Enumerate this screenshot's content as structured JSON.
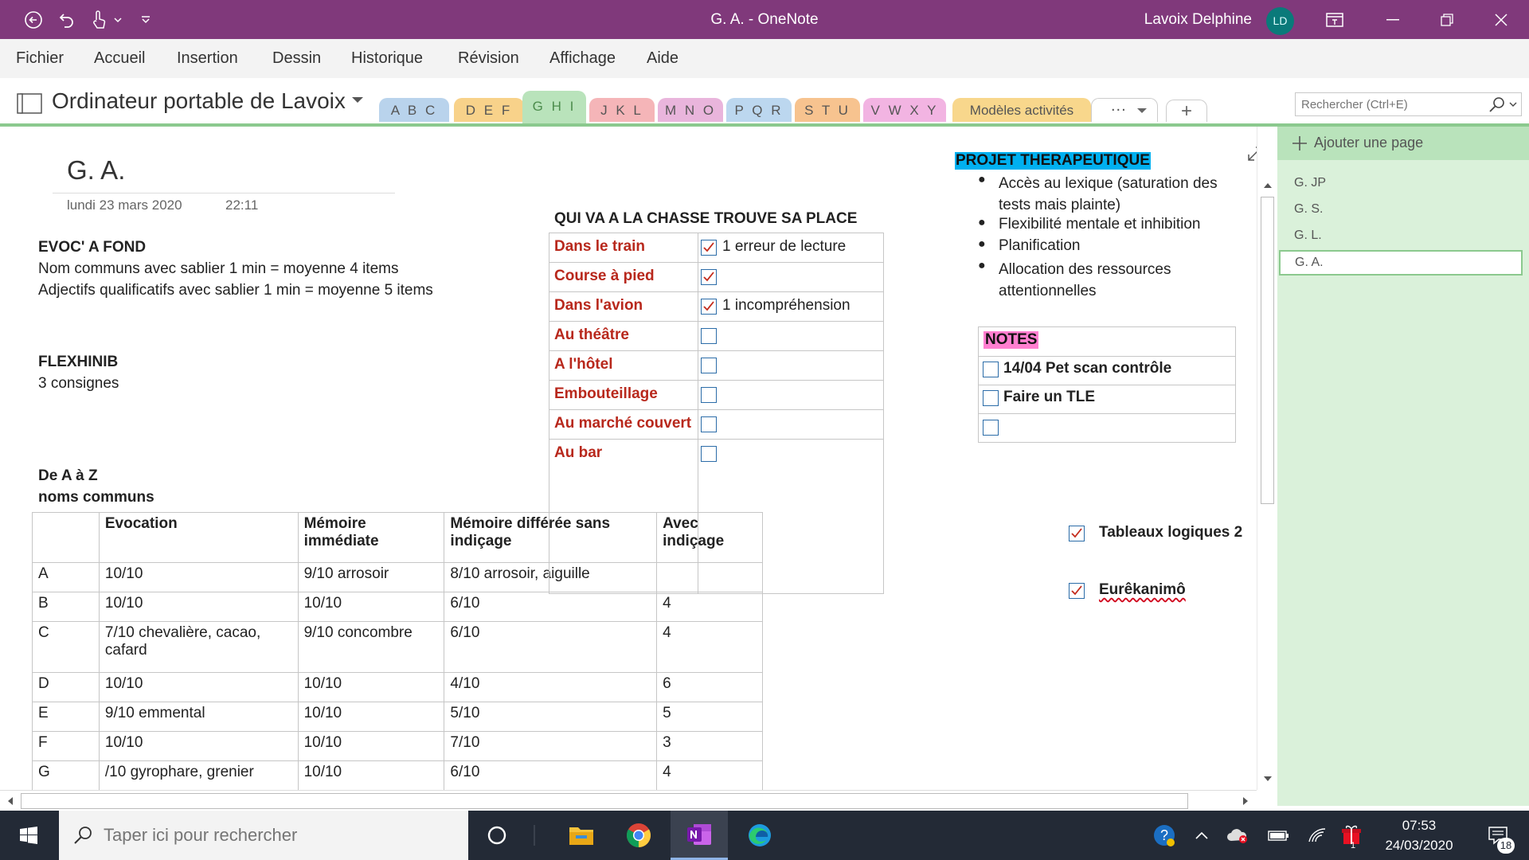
{
  "titlebar": {
    "title": "G. A.  -  OneNote",
    "user": "Lavoix Delphine",
    "avatar_initials": "LD",
    "accent": "#80397b"
  },
  "menu": [
    "Fichier",
    "Accueil",
    "Insertion",
    "Dessin",
    "Historique",
    "Révision",
    "Affichage",
    "Aide"
  ],
  "notebook": {
    "name": "Ordinateur portable de Lavoix",
    "tabs": [
      {
        "label": "A B C",
        "color": "#b9d3ec"
      },
      {
        "label": "D E F",
        "color": "#f8d28a"
      },
      {
        "label": "G H I",
        "color": "#b9e3bb",
        "active": true
      },
      {
        "label": "J K L",
        "color": "#f5b5b8"
      },
      {
        "label": "M N O",
        "color": "#e9b5dc"
      },
      {
        "label": "P Q R",
        "color": "#bcd7ef"
      },
      {
        "label": "S T U",
        "color": "#f7c38f"
      },
      {
        "label": "V W X Y Z",
        "color": "#f2b4e2"
      },
      {
        "label": "Modèles activités",
        "color": "#f8d78c"
      }
    ],
    "more_label": "...",
    "add_label": "+",
    "search_placeholder": "Rechercher (Ctrl+E)"
  },
  "page": {
    "title": "G. A.",
    "date": "lundi 23 mars 2020",
    "time": "22:11",
    "evoc": {
      "heading": "EVOC' A FOND",
      "line1": "Nom communs avec sablier 1 min = moyenne 4 items",
      "line2": "Adjectifs qualificatifs avec sablier 1 min = moyenne 5 items"
    },
    "flex": {
      "heading": "FLEXHINIB",
      "line": "3 consignes"
    },
    "az": {
      "heading": "De A à Z",
      "subheading": "noms communs"
    },
    "az_table": {
      "headers": [
        "",
        "Evocation",
        "Mémoire immédiate",
        "Mémoire différée sans indiçage",
        "Avec indiçage"
      ],
      "rows": [
        [
          "A",
          "10/10",
          "9/10 arrosoir",
          "8/10 arrosoir, aiguille",
          ""
        ],
        [
          "B",
          "10/10",
          "10/10",
          "6/10",
          "4"
        ],
        [
          "C",
          "7/10 chevalière, cacao, cafard",
          "9/10 concombre",
          "6/10",
          "4"
        ],
        [
          "D",
          "10/10",
          "10/10",
          "4/10",
          "6"
        ],
        [
          "E",
          "9/10  emmental",
          "10/10",
          "5/10",
          "5"
        ],
        [
          "F",
          "10/10",
          "10/10",
          "7/10",
          "3"
        ],
        [
          "G",
          "/10 gyrophare, grenier",
          "10/10",
          "6/10",
          "4"
        ]
      ]
    },
    "chasse": {
      "heading": "QUI VA A LA CHASSE TROUVE SA PLACE",
      "rows": [
        {
          "label": "Dans le train",
          "checked": true,
          "note": "1 erreur de lecture"
        },
        {
          "label": "Course à pied",
          "checked": true,
          "note": ""
        },
        {
          "label": "Dans l'avion",
          "checked": true,
          "note": "1 incompréhension"
        },
        {
          "label": "Au théâtre",
          "checked": false,
          "note": ""
        },
        {
          "label": "A l'hôtel",
          "checked": false,
          "note": ""
        },
        {
          "label": "Embouteillage",
          "checked": false,
          "note": ""
        },
        {
          "label": "Au marché couvert",
          "checked": false,
          "note": ""
        },
        {
          "label": "Au bar",
          "checked": false,
          "note": ""
        }
      ]
    },
    "projet": {
      "heading": "PROJET THERAPEUTIQUE",
      "highlight": "#00b0f0",
      "bullets": [
        "Accès au lexique (saturation des tests mais plainte)",
        "Flexibilité mentale et inhibition",
        "Planification",
        "Allocation des ressources attentionnelles"
      ]
    },
    "notes": {
      "heading": "NOTES",
      "highlight": "#ff7fd0",
      "items": [
        {
          "label": "14/04 Pet scan contrôle",
          "checked": false
        },
        {
          "label": "Faire un TLE",
          "checked": false
        },
        {
          "label": "",
          "checked": false
        }
      ]
    },
    "todos": [
      {
        "label": "Tableaux logiques 2",
        "checked": true
      },
      {
        "label": "Eurêkanimô",
        "checked": true
      }
    ]
  },
  "pages_panel": {
    "add_label": "Ajouter une page",
    "pages": [
      "G. JP",
      "G. S.",
      "G. L.",
      "G. A."
    ],
    "selected": "G. A."
  },
  "taskbar": {
    "search_placeholder": "Taper ici pour rechercher",
    "time": "07:53",
    "date": "24/03/2020",
    "notification_count": "18",
    "security_badge": "1"
  }
}
